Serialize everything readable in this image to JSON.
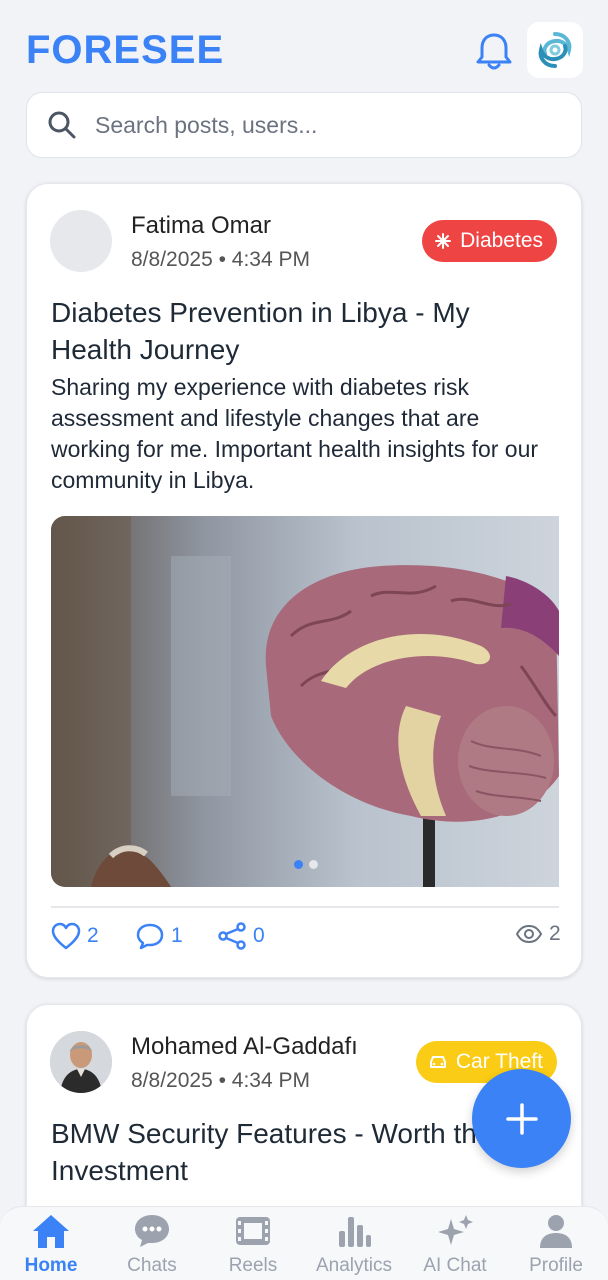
{
  "header": {
    "app_title": "FORESEE",
    "bell_icon": "bell-icon",
    "logo_icon": "swirl-logo-icon"
  },
  "search": {
    "placeholder": "Search posts, users..."
  },
  "posts": [
    {
      "author": "Fatima Omar",
      "date": "8/8/2025",
      "time": "4:34 PM",
      "category": "Diabetes",
      "category_color": "#ef4444",
      "title": "Diabetes Prevention in Libya - My Health Journey",
      "body": "Sharing my experience with diabetes risk assessment and lifestyle changes that are working for me. Important health insights for our community in Libya.",
      "image_count": 2,
      "active_image": 1,
      "likes": "2",
      "comments": "1",
      "shares": "0",
      "views": "2"
    },
    {
      "author": "Mohamed Al-Gaddafı",
      "date": "8/8/2025",
      "time": "4:34 PM",
      "category": "Car Theft",
      "category_color": "#facc15",
      "title": "BMW Security Features - Worth the Investment"
    }
  ],
  "nav": {
    "items": [
      {
        "label": "Home",
        "icon": "home-icon",
        "active": true
      },
      {
        "label": "Chats",
        "icon": "chat-bubble-icon",
        "active": false
      },
      {
        "label": "Reels",
        "icon": "film-icon",
        "active": false
      },
      {
        "label": "Analytics",
        "icon": "bar-chart-icon",
        "active": false
      },
      {
        "label": "AI Chat",
        "icon": "sparkles-icon",
        "active": false
      },
      {
        "label": "Profile",
        "icon": "user-icon",
        "active": false
      }
    ]
  },
  "colors": {
    "accent": "#3b82f6",
    "background": "#f1f3f7"
  }
}
